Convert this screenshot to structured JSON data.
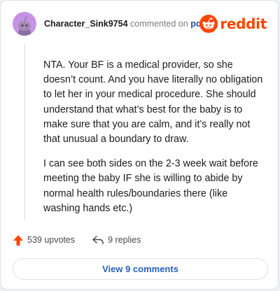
{
  "comment": {
    "username": "Character_Sink9754",
    "commented_text": "commented on",
    "post_link": "post",
    "brand": "reddit",
    "paragraphs": [
      "NTA. Your BF is a medical provider, so she doesn’t count. And you have literally no obligation to let her in your medical procedure. She should understand that what’s best for the baby is to make sure that you are calm, and it’s really not that unusual a boundary to draw.",
      "I can see both sides on the 2-3 week wait before meeting the baby IF she is willing to abide by normal health rules/boundaries there (like washing hands etc.)"
    ]
  },
  "actions": {
    "upvotes": "539 upvotes",
    "replies": "9 replies",
    "view_comments": "View 9 comments"
  },
  "icons": {
    "upvote": "upvote-arrow-icon",
    "reply": "reply-arrow-icon",
    "brand": "reddit-snoo-icon",
    "avatar": "snoo-avatar-icon"
  },
  "colors": {
    "brand_orange": "#ff4500",
    "link_blue": "#2a5fb8",
    "avatar_bg": "#c593e6"
  }
}
